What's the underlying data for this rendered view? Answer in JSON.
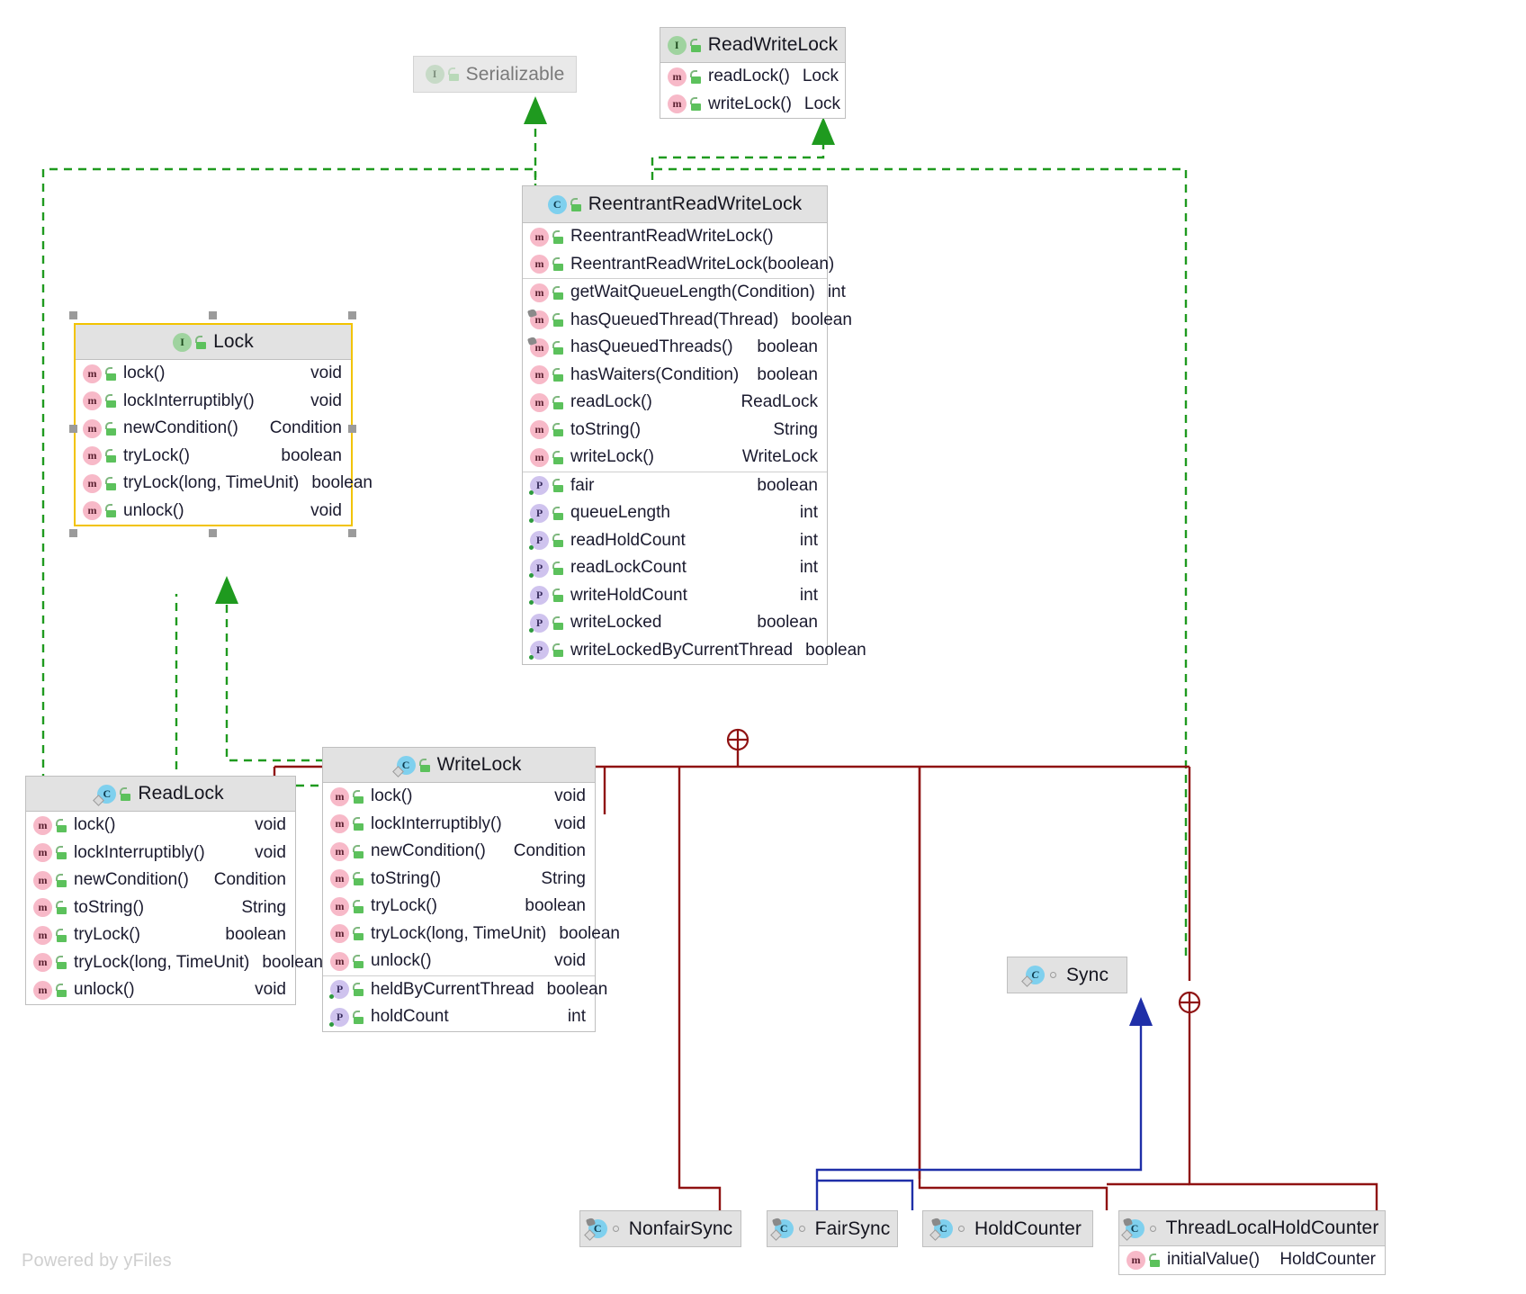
{
  "diagram": {
    "title": "ReentrantReadWriteLock class hierarchy",
    "watermark": "Powered by yFiles",
    "colors": {
      "inheritance_interface": "#1f9a1f",
      "inheritance_class": "#1f2fa8",
      "containment": "#8f1212",
      "header_fill": "#e2e2e2",
      "selection": "#f2c300",
      "method_icon": "#f7b9c8",
      "property_icon": "#cfc3ee",
      "class_icon": "#7fd0ee",
      "interface_icon": "#9fd39f"
    }
  },
  "nodes": {
    "serializable": {
      "name": "Serializable",
      "stereotype_icon": "interface-icon",
      "visibility_icon": "public-unlocked-icon",
      "members": []
    },
    "readwritelock": {
      "name": "ReadWriteLock",
      "stereotype_icon": "interface-icon",
      "visibility_icon": "public-unlocked-icon",
      "methods": [
        {
          "icon": "method-icon",
          "vis": "public-unlocked-icon",
          "name": "readLock()",
          "type": "Lock"
        },
        {
          "icon": "method-icon",
          "vis": "public-unlocked-icon",
          "name": "writeLock()",
          "type": "Lock"
        }
      ]
    },
    "reentrantreadwritelock": {
      "name": "ReentrantReadWriteLock",
      "stereotype_icon": "class-icon",
      "visibility_icon": "public-unlocked-icon",
      "constructors": [
        {
          "icon": "method-icon",
          "vis": "public-unlocked-icon",
          "name": "ReentrantReadWriteLock()",
          "type": ""
        },
        {
          "icon": "method-icon",
          "vis": "public-unlocked-icon",
          "name": "ReentrantReadWriteLock(boolean)",
          "type": ""
        }
      ],
      "methods": [
        {
          "icon": "method-icon",
          "vis": "public-unlocked-icon",
          "name": "getWaitQueueLength(Condition)",
          "type": "int"
        },
        {
          "icon": "method-static-icon",
          "vis": "public-unlocked-icon",
          "name": "hasQueuedThread(Thread)",
          "type": "boolean"
        },
        {
          "icon": "method-static-icon",
          "vis": "public-unlocked-icon",
          "name": "hasQueuedThreads()",
          "type": "boolean"
        },
        {
          "icon": "method-icon",
          "vis": "public-unlocked-icon",
          "name": "hasWaiters(Condition)",
          "type": "boolean"
        },
        {
          "icon": "method-icon",
          "vis": "public-unlocked-icon",
          "name": "readLock()",
          "type": "ReadLock"
        },
        {
          "icon": "method-icon",
          "vis": "public-unlocked-icon",
          "name": "toString()",
          "type": "String"
        },
        {
          "icon": "method-icon",
          "vis": "public-unlocked-icon",
          "name": "writeLock()",
          "type": "WriteLock"
        }
      ],
      "properties": [
        {
          "icon": "property-icon",
          "vis": "public-unlocked-icon",
          "name": "fair",
          "type": "boolean"
        },
        {
          "icon": "property-icon",
          "vis": "public-unlocked-icon",
          "name": "queueLength",
          "type": "int"
        },
        {
          "icon": "property-icon",
          "vis": "public-unlocked-icon",
          "name": "readHoldCount",
          "type": "int"
        },
        {
          "icon": "property-icon",
          "vis": "public-unlocked-icon",
          "name": "readLockCount",
          "type": "int"
        },
        {
          "icon": "property-icon",
          "vis": "public-unlocked-icon",
          "name": "writeHoldCount",
          "type": "int"
        },
        {
          "icon": "property-icon",
          "vis": "public-unlocked-icon",
          "name": "writeLocked",
          "type": "boolean"
        },
        {
          "icon": "property-icon",
          "vis": "public-unlocked-icon",
          "name": "writeLockedByCurrentThread",
          "type": "boolean"
        }
      ]
    },
    "lock": {
      "name": "Lock",
      "stereotype_icon": "interface-icon",
      "visibility_icon": "public-unlocked-icon",
      "selected": true,
      "methods": [
        {
          "icon": "method-icon",
          "vis": "public-unlocked-icon",
          "name": "lock()",
          "type": "void"
        },
        {
          "icon": "method-icon",
          "vis": "public-unlocked-icon",
          "name": "lockInterruptibly()",
          "type": "void"
        },
        {
          "icon": "method-icon",
          "vis": "public-unlocked-icon",
          "name": "newCondition()",
          "type": "Condition"
        },
        {
          "icon": "method-icon",
          "vis": "public-unlocked-icon",
          "name": "tryLock()",
          "type": "boolean"
        },
        {
          "icon": "method-icon",
          "vis": "public-unlocked-icon",
          "name": "tryLock(long, TimeUnit)",
          "type": "boolean"
        },
        {
          "icon": "method-icon",
          "vis": "public-unlocked-icon",
          "name": "unlock()",
          "type": "void"
        }
      ]
    },
    "readlock": {
      "name": "ReadLock",
      "stereotype_icon": "nested-class-icon",
      "visibility_icon": "public-unlocked-icon",
      "methods": [
        {
          "icon": "method-icon",
          "vis": "public-unlocked-icon",
          "name": "lock()",
          "type": "void"
        },
        {
          "icon": "method-icon",
          "vis": "public-unlocked-icon",
          "name": "lockInterruptibly()",
          "type": "void"
        },
        {
          "icon": "method-icon",
          "vis": "public-unlocked-icon",
          "name": "newCondition()",
          "type": "Condition"
        },
        {
          "icon": "method-icon",
          "vis": "public-unlocked-icon",
          "name": "toString()",
          "type": "String"
        },
        {
          "icon": "method-icon",
          "vis": "public-unlocked-icon",
          "name": "tryLock()",
          "type": "boolean"
        },
        {
          "icon": "method-icon",
          "vis": "public-unlocked-icon",
          "name": "tryLock(long, TimeUnit)",
          "type": "boolean"
        },
        {
          "icon": "method-icon",
          "vis": "public-unlocked-icon",
          "name": "unlock()",
          "type": "void"
        }
      ]
    },
    "writelock": {
      "name": "WriteLock",
      "stereotype_icon": "nested-class-icon",
      "visibility_icon": "public-unlocked-icon",
      "methods": [
        {
          "icon": "method-icon",
          "vis": "public-unlocked-icon",
          "name": "lock()",
          "type": "void"
        },
        {
          "icon": "method-icon",
          "vis": "public-unlocked-icon",
          "name": "lockInterruptibly()",
          "type": "void"
        },
        {
          "icon": "method-icon",
          "vis": "public-unlocked-icon",
          "name": "newCondition()",
          "type": "Condition"
        },
        {
          "icon": "method-icon",
          "vis": "public-unlocked-icon",
          "name": "toString()",
          "type": "String"
        },
        {
          "icon": "method-icon",
          "vis": "public-unlocked-icon",
          "name": "tryLock()",
          "type": "boolean"
        },
        {
          "icon": "method-icon",
          "vis": "public-unlocked-icon",
          "name": "tryLock(long, TimeUnit)",
          "type": "boolean"
        },
        {
          "icon": "method-icon",
          "vis": "public-unlocked-icon",
          "name": "unlock()",
          "type": "void"
        }
      ],
      "properties": [
        {
          "icon": "property-icon",
          "vis": "public-unlocked-icon",
          "name": "heldByCurrentThread",
          "type": "boolean"
        },
        {
          "icon": "property-icon",
          "vis": "public-unlocked-icon",
          "name": "holdCount",
          "type": "int"
        }
      ]
    },
    "sync": {
      "name": "Sync",
      "stereotype_icon": "abstract-nested-class-icon",
      "visibility_icon": "package-private-icon",
      "members": []
    },
    "nonfairsync": {
      "name": "NonfairSync",
      "stereotype_icon": "static-nested-class-icon",
      "visibility_icon": "package-private-icon",
      "members": []
    },
    "fairsync": {
      "name": "FairSync",
      "stereotype_icon": "static-nested-class-icon",
      "visibility_icon": "package-private-icon",
      "members": []
    },
    "holdcounter": {
      "name": "HoldCounter",
      "stereotype_icon": "static-nested-class-icon",
      "visibility_icon": "package-private-icon",
      "members": []
    },
    "threadlocalholdcounter": {
      "name": "ThreadLocalHoldCounter",
      "stereotype_icon": "static-nested-class-icon",
      "visibility_icon": "package-private-icon",
      "methods": [
        {
          "icon": "method-icon",
          "vis": "public-unlocked-icon",
          "name": "initialValue()",
          "type": "HoldCounter"
        }
      ]
    }
  },
  "edges": [
    {
      "from": "reentrantreadwritelock",
      "to": "serializable",
      "kind": "realization"
    },
    {
      "from": "reentrantreadwritelock",
      "to": "readwritelock",
      "kind": "realization"
    },
    {
      "from": "readlock",
      "to": "lock",
      "kind": "realization"
    },
    {
      "from": "writelock",
      "to": "lock",
      "kind": "realization"
    },
    {
      "from": "readlock",
      "to": "serializable",
      "kind": "realization"
    },
    {
      "from": "writelock",
      "to": "serializable",
      "kind": "realization"
    },
    {
      "from": "sync",
      "to": "serializable",
      "kind": "realization"
    },
    {
      "from": "reentrantreadwritelock",
      "to": "readlock",
      "kind": "containment"
    },
    {
      "from": "reentrantreadwritelock",
      "to": "writelock",
      "kind": "containment"
    },
    {
      "from": "reentrantreadwritelock",
      "to": "sync",
      "kind": "containment"
    },
    {
      "from": "reentrantreadwritelock",
      "to": "nonfairsync",
      "kind": "containment"
    },
    {
      "from": "reentrantreadwritelock",
      "to": "fairsync",
      "kind": "containment"
    },
    {
      "from": "sync",
      "to": "holdcounter",
      "kind": "containment"
    },
    {
      "from": "sync",
      "to": "threadlocalholdcounter",
      "kind": "containment"
    },
    {
      "from": "nonfairsync",
      "to": "sync",
      "kind": "generalization"
    },
    {
      "from": "fairsync",
      "to": "sync",
      "kind": "generalization"
    }
  ]
}
